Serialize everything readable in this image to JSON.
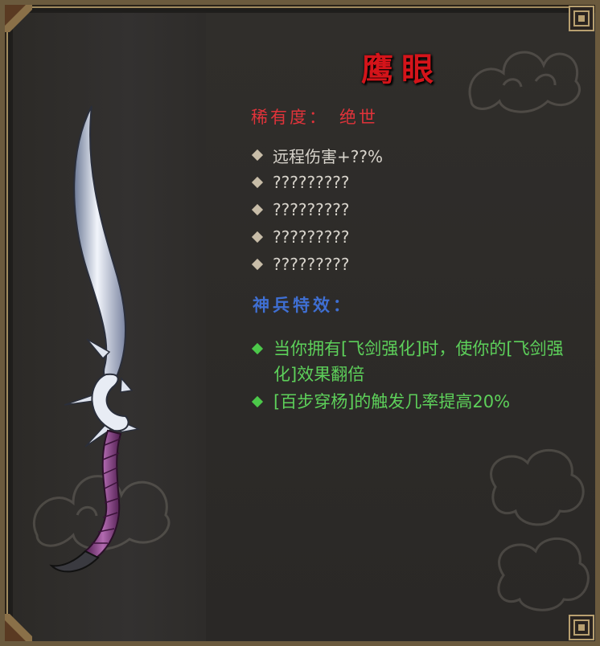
{
  "item": {
    "name": "鹰眼",
    "rarity_label": "稀有度：",
    "rarity_value": "绝世"
  },
  "stats": [
    {
      "text": "远程伤害+??%"
    },
    {
      "text": "?????????"
    },
    {
      "text": "?????????"
    },
    {
      "text": "?????????"
    },
    {
      "text": "?????????"
    }
  ],
  "effects_header": "神兵特效：",
  "effects": [
    {
      "text": "当你拥有[飞剑强化]时，使你的[飞剑强化]效果翻倍"
    },
    {
      "text": "[百步穿杨]的触发几率提高20%"
    }
  ],
  "colors": {
    "title": "#d4141a",
    "rarity": "#e0333a",
    "stat_text": "#d8d4cc",
    "effects_header": "#3f6fd2",
    "effect_text": "#5dd05a",
    "frame_gold": "#a08a5e"
  },
  "icons": {
    "weapon": "curved-blade-icon",
    "stat_bullet": "diamond-bullet-icon",
    "effect_bullet": "green-diamond-bullet-icon"
  }
}
